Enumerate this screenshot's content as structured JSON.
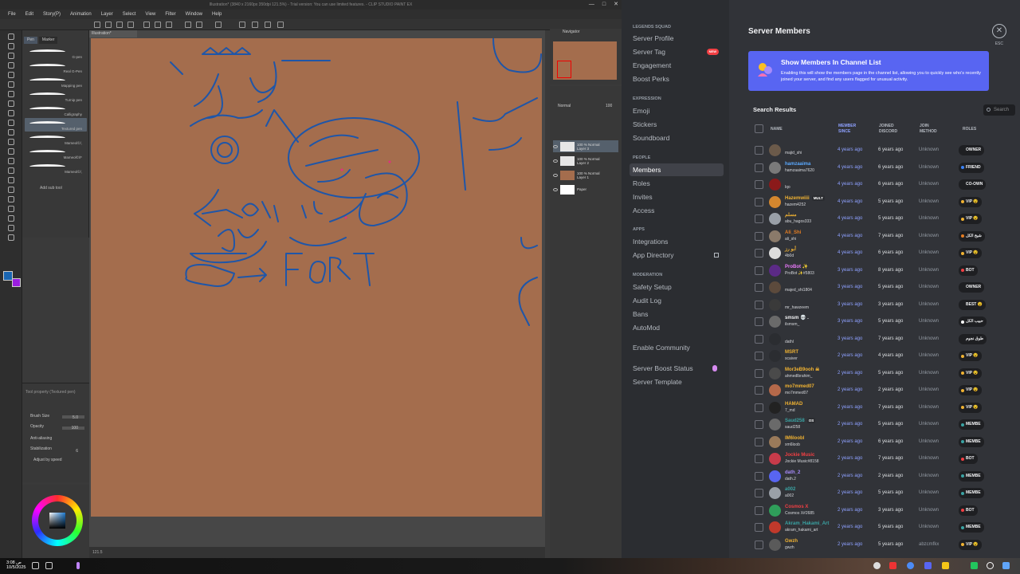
{
  "csp": {
    "title": "Illustration* (3840 x 2160px 350dpi 121.5%) - Trial version: You can use limited features. - CLIP STUDIO PAINT EX",
    "win_buttons": [
      "—",
      "□",
      "✕"
    ],
    "menu": [
      "File",
      "Edit",
      "Story(P)",
      "Animation",
      "Layer",
      "Select",
      "View",
      "Filter",
      "Window",
      "Help"
    ],
    "subtool_tabs": [
      "Pen",
      "Marker"
    ],
    "brushes": [
      "G-pen",
      "Real G-Pen",
      "Mapping pen",
      "Turnip pen",
      "Calligraphy",
      "Textured pen",
      "Mameol©/,",
      "Mameol©/F",
      "Mameol©/,"
    ],
    "active_brush_index": 5,
    "add_subtool": "Add sub tool",
    "canvas_tab": "Illustration*",
    "tool_property": {
      "title": "Tool property (Textured pen)",
      "brush_size_label": "Brush Size",
      "brush_size": "5.0",
      "opacity_label": "Opacity",
      "opacity": "100",
      "anti_alias_label": "Anti-aliasing",
      "stabilization_label": "Stabilization",
      "stabilization": "6",
      "adjust_by_speed": "Adjust by speed"
    },
    "canvas_status": "121.5",
    "navigator_title": "Navigator",
    "layers": [
      {
        "line1": "100 % Normal",
        "line2": "Layer 3"
      },
      {
        "line1": "100 % Normal",
        "line2": "Layer 2"
      },
      {
        "line1": "100 % Normal",
        "line2": "Layer 1"
      },
      {
        "line1": "",
        "line2": "Paper"
      }
    ],
    "layer_blend": "Normal",
    "layer_opacity": "100",
    "colors": {
      "main": "#1a66b3",
      "sub": "#9b1de0",
      "paper": "#a46d4d"
    }
  },
  "discord": {
    "sidebar": {
      "group_title": "LEGENDS SQUAD",
      "items_top": [
        "Server Profile",
        "Server Tag",
        "Engagement",
        "Boost Perks"
      ],
      "new_badge": "NEW",
      "expression_head": "EXPRESSION",
      "expression_items": [
        "Emoji",
        "Stickers",
        "Soundboard"
      ],
      "people_head": "PEOPLE",
      "people_items": [
        "Members",
        "Roles",
        "Invites",
        "Access"
      ],
      "apps_head": "APPS",
      "apps_items": [
        "Integrations",
        "App Directory"
      ],
      "moderation_head": "MODERATION",
      "moderation_items": [
        "Safety Setup",
        "Audit Log",
        "Bans",
        "AutoMod"
      ],
      "enable_community": "Enable Community",
      "boost_status": "Server Boost Status",
      "server_template": "Server Template"
    },
    "title": "Server Members",
    "esc": "ESC",
    "banner": {
      "title": "Show Members In Channel List",
      "desc": "Enabling this will show the members page in the channel list, allowing you to quickly see who's recently joined your server, and find any users flagged for unusual activity."
    },
    "search_results": "Search Results",
    "search_placeholder": "Search",
    "columns": {
      "name": "NAME",
      "member_since": "MEMBER SINCE",
      "joined_discord": "JOINED DISCORD",
      "join_method": "JOIN METHOD",
      "roles": "ROLES"
    },
    "rows": [
      {
        "name": "",
        "user": "majid_shi",
        "since": "4 years ago",
        "joined": "6 years ago",
        "method": "Unknown",
        "role": "OWNER",
        "av": "#6b5a4a",
        "nc": "#f2f3f5",
        "dot": ""
      },
      {
        "name": "hamzaaima",
        "user": "hamzaaima7620",
        "since": "4 years ago",
        "joined": "6 years ago",
        "method": "Unknown",
        "role": "FRIEND",
        "av": "#7a7a7a",
        "nc": "#5aa9ff",
        "dot": "#3b82f6"
      },
      {
        "name": "",
        "user": "lqo",
        "since": "4 years ago",
        "joined": "6 years ago",
        "method": "Unknown",
        "role": "CO-OWN",
        "av": "#8b1a1a",
        "nc": "#f23f43",
        "dot": ""
      },
      {
        "name": "Hazemwiiii",
        "user": "hazem4252",
        "since": "4 years ago",
        "joined": "5 years ago",
        "method": "Unknown",
        "role": "VIP 😵",
        "av": "#d4872e",
        "nc": "#f0b232",
        "dot": "#f0b232",
        "tag": "MULT"
      },
      {
        "name": "مسلم",
        "user": "abu_hagos333",
        "since": "4 years ago",
        "joined": "5 years ago",
        "method": "Unknown",
        "role": "VIP 😵",
        "av": "#9aa0a8",
        "nc": "#f0b232",
        "dot": "#f0b232"
      },
      {
        "name": "Ali_Shi",
        "user": "ali_shi",
        "since": "4 years ago",
        "joined": "7 years ago",
        "method": "Unknown",
        "role": "شيخ الكل",
        "av": "#8a7a6a",
        "nc": "#e67e22",
        "dot": "#e67e22"
      },
      {
        "name": "أبو رز",
        "user": "4b0d",
        "since": "4 years ago",
        "joined": "6 years ago",
        "method": "Unknown",
        "role": "VIP 😵",
        "av": "#dcdcdc",
        "nc": "#f0b232",
        "dot": "#f0b232"
      },
      {
        "name": "ProBot ✨",
        "user": "ProBot ✨#5803",
        "since": "3 years ago",
        "joined": "8 years ago",
        "method": "Unknown",
        "role": "BOT",
        "av": "#5b2a86",
        "nc": "#e879f9",
        "dot": "#f23f43"
      },
      {
        "name": "",
        "user": "majed_shi1804",
        "since": "3 years ago",
        "joined": "5 years ago",
        "method": "Unknown",
        "role": "OWNER",
        "av": "#5c4a3c",
        "nc": "#f2f3f5",
        "dot": ""
      },
      {
        "name": "",
        "user": "mr_hawzeem",
        "since": "3 years ago",
        "joined": "3 years ago",
        "method": "Unknown",
        "role": "BEST 😵",
        "av": "#3a3a3a",
        "nc": "#f2f3f5",
        "dot": ""
      },
      {
        "name": "smsm 💀 .",
        "user": "ilsmsm_",
        "since": "3 years ago",
        "joined": "5 years ago",
        "method": "Unknown",
        "role": "حبيب الكل",
        "av": "#6a6a6a",
        "nc": "#f2f3f5",
        "dot": "#ffffff"
      },
      {
        "name": "",
        "user": "dathl",
        "since": "3 years ago",
        "joined": "7 years ago",
        "method": "Unknown",
        "role": "طوق نجوم",
        "av": "#2b2d31",
        "nc": "#f2f3f5",
        "dot": ""
      },
      {
        "name": "MSRT",
        "user": "scaiver",
        "since": "2 years ago",
        "joined": "4 years ago",
        "method": "Unknown",
        "role": "VIP 😵",
        "av": "#2b2d31",
        "nc": "#f0b232",
        "dot": "#f0b232"
      },
      {
        "name": "Mor3eB9ooh ☠",
        "user": "ahmedlbrahim_",
        "since": "2 years ago",
        "joined": "5 years ago",
        "method": "Unknown",
        "role": "VIP 😵",
        "av": "#4a4a4a",
        "nc": "#f0b232",
        "dot": "#f0b232"
      },
      {
        "name": "mo7mmed07",
        "user": "mo7mmed07",
        "since": "2 years ago",
        "joined": "2 years ago",
        "method": "Unknown",
        "role": "VIP 😵",
        "av": "#b5694a",
        "nc": "#f0b232",
        "dot": "#f0b232"
      },
      {
        "name": "HAMAD",
        "user": "7_md",
        "since": "2 years ago",
        "joined": "7 years ago",
        "method": "Unknown",
        "role": "VIP 😵",
        "av": "#222222",
        "nc": "#f0b232",
        "dot": "#f0b232"
      },
      {
        "name": "Saud258",
        "user": "saud258",
        "since": "2 years ago",
        "joined": "5 years ago",
        "method": "Unknown",
        "role": "MEMBE",
        "av": "#6a6a6a",
        "nc": "#3aa3a3",
        "dot": "#3aa3a3",
        "tag": "OS"
      },
      {
        "name": "IM6loobl",
        "user": "xm6loob",
        "since": "2 years ago",
        "joined": "6 years ago",
        "method": "Unknown",
        "role": "MEMBE",
        "av": "#9a7a5a",
        "nc": "#f0b232",
        "dot": "#3aa3a3"
      },
      {
        "name": "Jockie Music",
        "user": "Jockie Music#8158",
        "since": "2 years ago",
        "joined": "7 years ago",
        "method": "Unknown",
        "role": "BOT",
        "av": "#c73b4a",
        "nc": "#f23f43",
        "dot": "#f23f43"
      },
      {
        "name": "dath_2",
        "user": "dath.2",
        "since": "2 years ago",
        "joined": "2 years ago",
        "method": "Unknown",
        "role": "MEMBE",
        "av": "#5865f2",
        "nc": "#a78bfa",
        "dot": "#3aa3a3"
      },
      {
        "name": "a002",
        "user": "a002",
        "since": "2 years ago",
        "joined": "5 years ago",
        "method": "Unknown",
        "role": "MEMBE",
        "av": "#9aa0a8",
        "nc": "#3aa3a3",
        "dot": "#3aa3a3"
      },
      {
        "name": "Cosmos X",
        "user": "Cosmos X#2685",
        "since": "2 years ago",
        "joined": "3 years ago",
        "method": "Unknown",
        "role": "BOT",
        "av": "#2f9e5a",
        "nc": "#f23f43",
        "dot": "#f23f43"
      },
      {
        "name": "Akram_Hakami_Art",
        "user": "akram_hakami_art",
        "since": "2 years ago",
        "joined": "5 years ago",
        "method": "Unknown",
        "role": "MEMBE",
        "av": "#c0392b",
        "nc": "#3aa3a3",
        "dot": "#3aa3a3"
      },
      {
        "name": "Gwzh",
        "user": "gwzh",
        "since": "2 years ago",
        "joined": "5 years ago",
        "method": "abzcmfkx",
        "role": "VIP 😵",
        "av": "#5a5a5a",
        "nc": "#f0b232",
        "dot": "#f0b232"
      }
    ]
  },
  "taskbar": {
    "time": "ص 3:08",
    "date": "10/5/2025"
  }
}
